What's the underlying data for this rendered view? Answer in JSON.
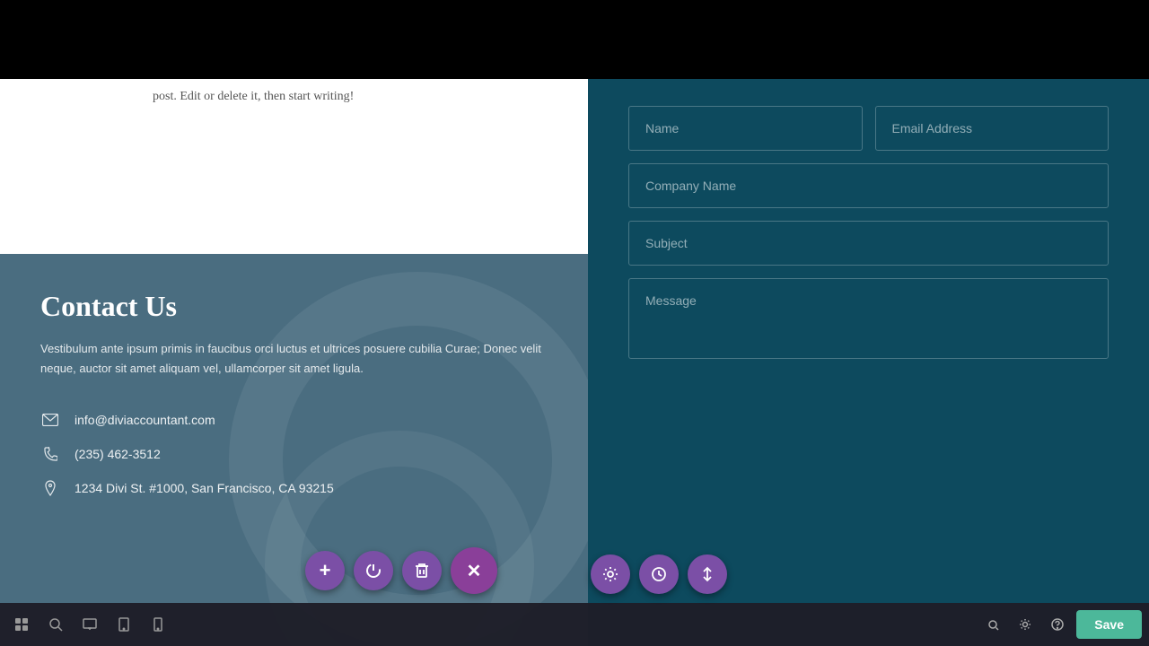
{
  "top_bar": {
    "bg": "#000"
  },
  "white_section": {
    "text": "post. Edit or delete it, then start writing!"
  },
  "contact": {
    "title": "Contact Us",
    "description": "Vestibulum ante ipsum primis in faucibus orci luctus et ultrices posuere cubilia Curae; Donec velit neque, auctor sit amet aliquam vel, ullamcorper sit amet ligula.",
    "email": "info@diviaccountant.com",
    "phone": "(235) 462-3512",
    "address": "1234 Divi St. #1000, San Francisco, CA 93215"
  },
  "form": {
    "name_placeholder": "Name",
    "email_placeholder": "Email Address",
    "company_placeholder": "Company Name",
    "subject_placeholder": "Subject",
    "message_placeholder": "Message"
  },
  "toolbar": {
    "save_label": "Save",
    "fab_add": "+",
    "fab_power": "⏻",
    "fab_trash": "🗑",
    "fab_close": "✕",
    "fab_settings": "⚙",
    "fab_history": "🕐",
    "fab_sort": "⇅"
  }
}
